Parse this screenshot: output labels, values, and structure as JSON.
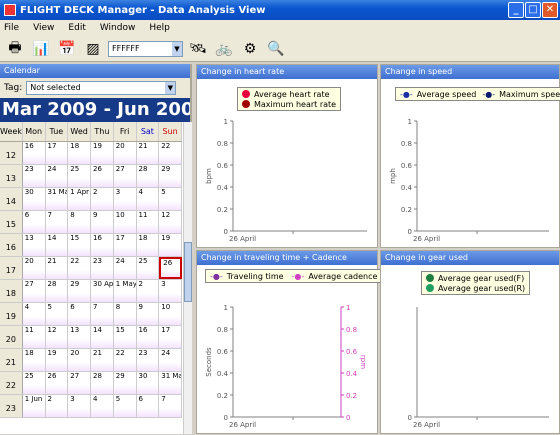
{
  "window": {
    "title": "FLIGHT DECK Manager - Data Analysis View"
  },
  "menu": [
    "File",
    "View",
    "Edit",
    "Window",
    "Help"
  ],
  "toolbar": {
    "color_value": "FFFFFF"
  },
  "calendar": {
    "header": "Calendar",
    "tag_label": "Tag:",
    "tag_value": "Not selected",
    "range": "Mar 2009 - Jun 2009",
    "col_headers": [
      "Week",
      "Mon",
      "Tue",
      "Wed",
      "Thu",
      "Fri",
      "Sat",
      "Sun"
    ],
    "rows": [
      {
        "wk": "12",
        "days": [
          "16",
          "17",
          "18",
          "19",
          "20",
          "21",
          "22"
        ]
      },
      {
        "wk": "13",
        "days": [
          "23",
          "24",
          "25",
          "26",
          "27",
          "28",
          "29"
        ]
      },
      {
        "wk": "14",
        "days": [
          "30",
          "31 Mar",
          "1 Apr",
          "2",
          "3",
          "4",
          "5"
        ]
      },
      {
        "wk": "15",
        "days": [
          "6",
          "7",
          "8",
          "9",
          "10",
          "11",
          "12"
        ]
      },
      {
        "wk": "16",
        "days": [
          "13",
          "14",
          "15",
          "16",
          "17",
          "18",
          "19"
        ]
      },
      {
        "wk": "17",
        "days": [
          "20",
          "21",
          "22",
          "23",
          "24",
          "25",
          "26"
        ]
      },
      {
        "wk": "18",
        "days": [
          "27",
          "28",
          "29",
          "30 Apr",
          "1 May",
          "2",
          "3"
        ]
      },
      {
        "wk": "19",
        "days": [
          "4",
          "5",
          "6",
          "7",
          "8",
          "9",
          "10"
        ]
      },
      {
        "wk": "20",
        "days": [
          "11",
          "12",
          "13",
          "14",
          "15",
          "16",
          "17"
        ]
      },
      {
        "wk": "21",
        "days": [
          "18",
          "19",
          "20",
          "21",
          "22",
          "23",
          "24"
        ]
      },
      {
        "wk": "22",
        "days": [
          "25",
          "26",
          "27",
          "28",
          "29",
          "30",
          "31 May"
        ]
      },
      {
        "wk": "23",
        "days": [
          "1 Jun",
          "2",
          "3",
          "4",
          "5",
          "6",
          "7"
        ]
      }
    ]
  },
  "colors": {
    "hr_avg": "#e8003c",
    "hr_max": "#a00000",
    "spd_avg": "#1a2ea8",
    "spd_max": "#0a1a70",
    "time": "#8030a0",
    "cad": "#d040c0",
    "gear_f": "#208040",
    "gear_r": "#20a060",
    "sun": "#cc0000",
    "sat": "#0000cc"
  },
  "chart_data": [
    {
      "type": "line",
      "title": "Change in heart rate",
      "ylabel": "bpm",
      "x_tick": "26 April",
      "ylim": [
        0,
        1
      ],
      "yticks": [
        "0",
        "0.2",
        "0.4",
        "0.6",
        "0.8",
        "1"
      ],
      "series": [
        {
          "name": "Average heart rate",
          "values": []
        },
        {
          "name": "Maximum heart rate",
          "values": []
        }
      ]
    },
    {
      "type": "line",
      "title": "Change in speed",
      "ylabel": "mph",
      "x_tick": "26 April",
      "ylim": [
        0,
        1
      ],
      "yticks": [
        "0",
        "0.2",
        "0.4",
        "0.6",
        "0.8",
        "1"
      ],
      "series": [
        {
          "name": "Average speed",
          "values": []
        },
        {
          "name": "Maximum speed",
          "values": []
        }
      ]
    },
    {
      "type": "line",
      "title": "Change in traveling time + Cadence",
      "ylabel": "Seconds",
      "y2label": "rpm",
      "x_tick": "26 April",
      "ylim": [
        0,
        1
      ],
      "yticks": [
        "0",
        "0.2",
        "0.4",
        "0.6",
        "0.8",
        "1"
      ],
      "series": [
        {
          "name": "Traveling time",
          "values": []
        },
        {
          "name": "Average cadence",
          "values": []
        }
      ]
    },
    {
      "type": "line",
      "title": "Change in gear used",
      "x_tick": "26 April",
      "ylim": [
        0,
        1
      ],
      "yticks": [
        "0"
      ],
      "series": [
        {
          "name": "Average gear used(F)",
          "values": []
        },
        {
          "name": "Average gear used(R)",
          "values": []
        }
      ]
    }
  ]
}
